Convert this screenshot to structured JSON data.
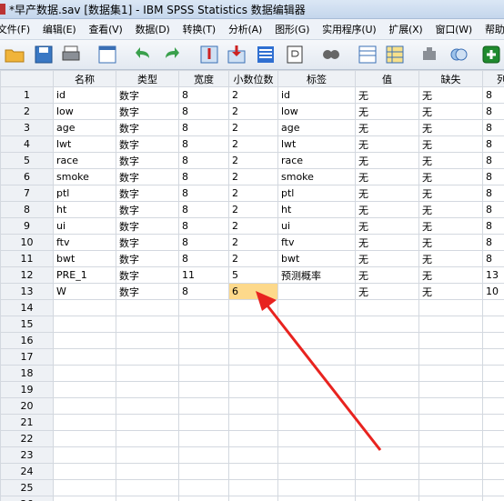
{
  "window": {
    "title": "*早产数据.sav [数据集1] - IBM SPSS Statistics 数据编辑器"
  },
  "menu": [
    "文件(F)",
    "编辑(E)",
    "查看(V)",
    "数据(D)",
    "转换(T)",
    "分析(A)",
    "图形(G)",
    "实用程序(U)",
    "扩展(X)",
    "窗口(W)",
    "帮助(H)"
  ],
  "toolbar": [
    {
      "icon": "open-folder-icon"
    },
    {
      "icon": "save-icon"
    },
    {
      "icon": "print-icon"
    },
    {
      "icon": "recall-dialog-icon"
    },
    {
      "icon": "undo-icon"
    },
    {
      "icon": "redo-icon"
    },
    {
      "icon": "goto-case-icon"
    },
    {
      "icon": "goto-variable-icon"
    },
    {
      "icon": "variables-icon"
    },
    {
      "icon": "run-descriptives-icon"
    },
    {
      "icon": "find-icon"
    },
    {
      "icon": "split-file-icon"
    },
    {
      "icon": "weight-cases-icon"
    },
    {
      "icon": "select-cases-icon"
    },
    {
      "icon": "value-labels-icon"
    },
    {
      "icon": "add-icon"
    }
  ],
  "columns": [
    "名称",
    "类型",
    "宽度",
    "小数位数",
    "标签",
    "值",
    "缺失",
    "列"
  ],
  "rows": [
    [
      "id",
      "数字",
      "8",
      "2",
      "id",
      "无",
      "无",
      "8"
    ],
    [
      "low",
      "数字",
      "8",
      "2",
      "low",
      "无",
      "无",
      "8"
    ],
    [
      "age",
      "数字",
      "8",
      "2",
      "age",
      "无",
      "无",
      "8"
    ],
    [
      "lwt",
      "数字",
      "8",
      "2",
      "lwt",
      "无",
      "无",
      "8"
    ],
    [
      "race",
      "数字",
      "8",
      "2",
      "race",
      "无",
      "无",
      "8"
    ],
    [
      "smoke",
      "数字",
      "8",
      "2",
      "smoke",
      "无",
      "无",
      "8"
    ],
    [
      "ptl",
      "数字",
      "8",
      "2",
      "ptl",
      "无",
      "无",
      "8"
    ],
    [
      "ht",
      "数字",
      "8",
      "2",
      "ht",
      "无",
      "无",
      "8"
    ],
    [
      "ui",
      "数字",
      "8",
      "2",
      "ui",
      "无",
      "无",
      "8"
    ],
    [
      "ftv",
      "数字",
      "8",
      "2",
      "ftv",
      "无",
      "无",
      "8"
    ],
    [
      "bwt",
      "数字",
      "8",
      "2",
      "bwt",
      "无",
      "无",
      "8"
    ],
    [
      "PRE_1",
      "数字",
      "11",
      "5",
      "预测概率",
      "无",
      "无",
      "13"
    ],
    [
      "W",
      "数字",
      "8",
      "6",
      "",
      "无",
      "无",
      "10"
    ]
  ],
  "selected_cell": {
    "row": 13,
    "column": "小数位数"
  },
  "total_row_numbers": 26,
  "colors": {
    "selected_cell": "#fdd98b",
    "annotation_arrow": "#e8231f"
  }
}
